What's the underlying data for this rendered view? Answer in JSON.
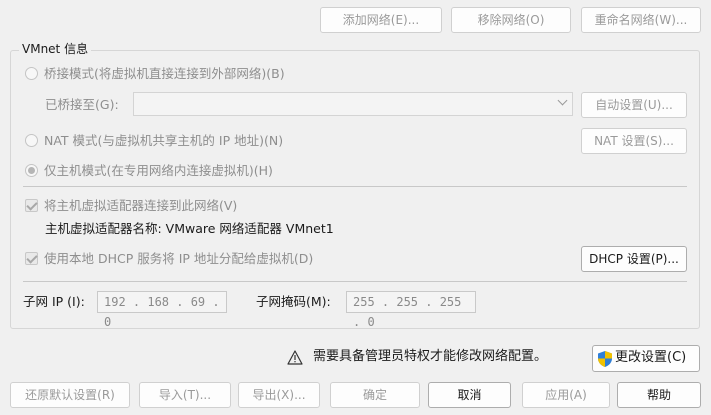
{
  "toolbar": {
    "add_network": "添加网络(E)...",
    "remove_network": "移除网络(O)",
    "rename_network": "重命名网络(W)..."
  },
  "vmnet_info": {
    "legend": "VMnet 信息",
    "bridged_mode": "桥接模式(将虚拟机直接连接到外部网络)(B)",
    "bridged_to_label": "已桥接至(G):",
    "bridged_to_value": "",
    "auto_settings": "自动设置(U)...",
    "nat_mode": "NAT 模式(与虚拟机共享主机的 IP 地址)(N)",
    "nat_settings": "NAT 设置(S)...",
    "host_only_mode": "仅主机模式(在专用网络内连接虚拟机)(H)",
    "selected_mode": "host_only",
    "connect_adapter": "将主机虚拟适配器连接到此网络(V)",
    "connect_adapter_checked": true,
    "adapter_name_label": "主机虚拟适配器名称: VMware 网络适配器 VMnet1",
    "use_dhcp": "使用本地 DHCP 服务将 IP 地址分配给虚拟机(D)",
    "use_dhcp_checked": true,
    "dhcp_settings": "DHCP 设置(P)...",
    "subnet_ip_label": "子网 IP (I):",
    "subnet_ip_value": "192 . 168 . 69 . 0",
    "subnet_mask_label": "子网掩码(M):",
    "subnet_mask_value": "255 . 255 . 255 . 0"
  },
  "admin_notice": {
    "text": "需要具备管理员特权才能修改网络配置。",
    "change_settings": "更改设置(C)"
  },
  "footer": {
    "restore_defaults": "还原默认设置(R)",
    "import": "导入(T)...",
    "export": "导出(X)...",
    "ok": "确定",
    "cancel": "取消",
    "apply": "应用(A)",
    "help": "帮助"
  },
  "colors": {
    "background": "#f0f0f0",
    "disabled_text": "#9a9a9a",
    "shield_blue": "#2f7fd8",
    "shield_yellow": "#f2c200"
  }
}
